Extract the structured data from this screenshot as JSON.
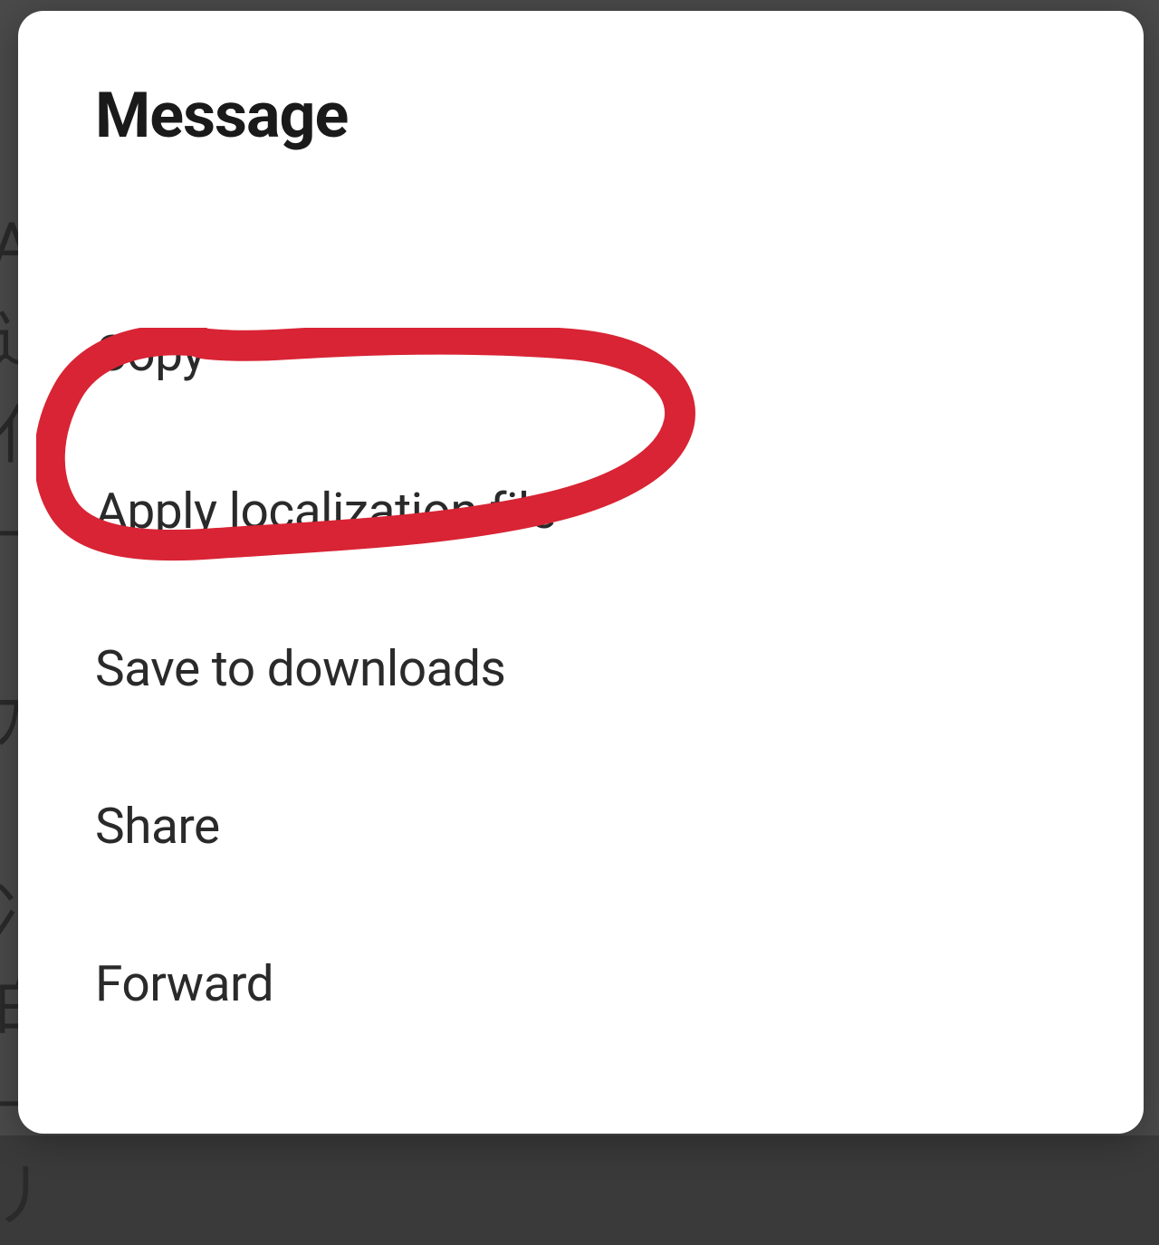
{
  "dialog": {
    "title": "Message",
    "items": [
      {
        "label": "Copy"
      },
      {
        "label": "Apply localization file"
      },
      {
        "label": "Save to downloads"
      },
      {
        "label": "Share"
      },
      {
        "label": "Forward"
      }
    ]
  },
  "annotation": {
    "highlighted_item_index": 1,
    "color": "#d82434"
  }
}
